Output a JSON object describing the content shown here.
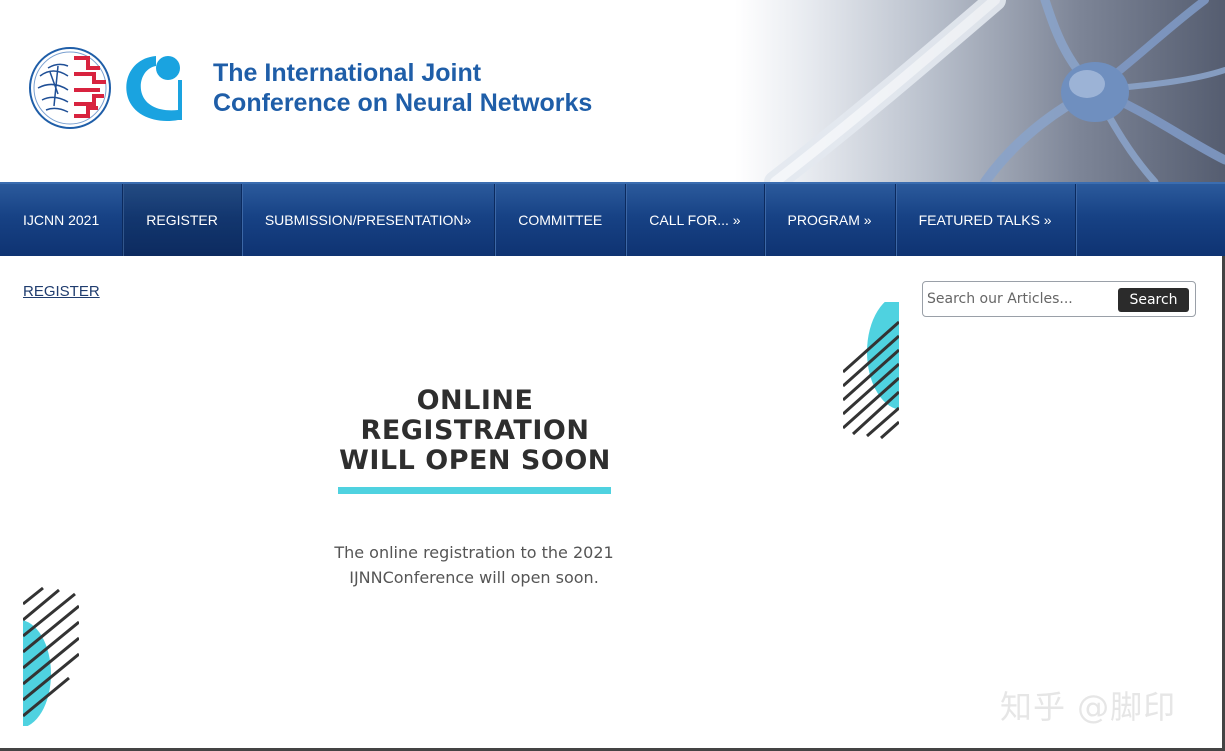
{
  "header": {
    "title_line1": "The International Joint",
    "title_line2": "Conference on Neural Networks"
  },
  "nav": {
    "items": [
      {
        "label": "IJCNN 2021"
      },
      {
        "label": "REGISTER"
      },
      {
        "label": "SUBMISSION/PRESENTATION»"
      },
      {
        "label": "COMMITTEE"
      },
      {
        "label": "CALL FOR... »"
      },
      {
        "label": "PROGRAM »"
      },
      {
        "label": "FEATURED TALKS »"
      }
    ]
  },
  "breadcrumb": "REGISTER",
  "search": {
    "placeholder": "Search our Articles...",
    "button_label": "Search"
  },
  "promo": {
    "title_line1": "ONLINE",
    "title_line2": "REGISTRATION",
    "title_line3": "WILL OPEN SOON",
    "text_line1": "The online registration to the 2021",
    "text_line2": "IJNNConference will open soon."
  },
  "watermark": "知乎 @脚印",
  "colors": {
    "nav_bg": "#174285",
    "title_blue": "#1f5ea8",
    "accent_cyan": "#4fd2e0",
    "search_button": "#2b2b2b"
  }
}
